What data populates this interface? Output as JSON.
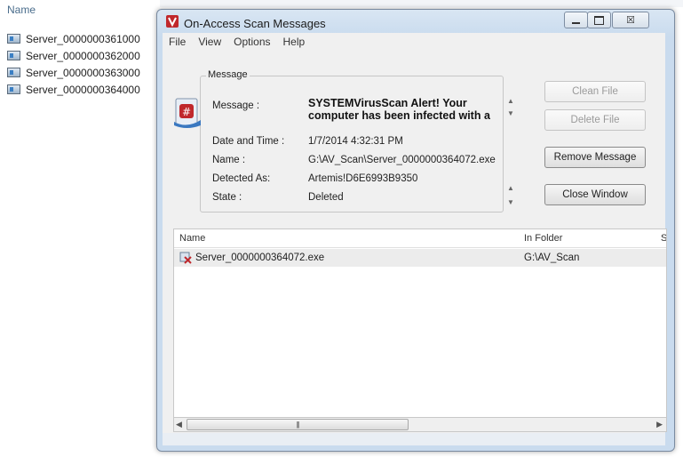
{
  "background": {
    "header": "Name",
    "items": [
      "Server_0000000361000",
      "Server_0000000362000",
      "Server_0000000363000",
      "Server_0000000364000"
    ]
  },
  "window": {
    "title": "On-Access Scan Messages",
    "menu": [
      "File",
      "View",
      "Options",
      "Help"
    ],
    "close_glyph": "☒"
  },
  "message": {
    "group_label": "Message",
    "labels": {
      "message": "Message :",
      "datetime": "Date and Time :",
      "name": "Name :",
      "detected": "Detected As:",
      "state": "State :"
    },
    "values": {
      "message": "SYSTEMVirusScan Alert! Your computer has been infected with a",
      "datetime": "1/7/2014 4:32:31 PM",
      "name": "G:\\AV_Scan\\Server_0000000364072.exe",
      "detected": "Artemis!D6E6993B9350",
      "state": "Deleted"
    }
  },
  "buttons": {
    "clean": "Clean File",
    "delete": "Delete File",
    "remove": "Remove Message",
    "close": "Close Window"
  },
  "list": {
    "columns": [
      "Name",
      "In Folder",
      "S"
    ],
    "rows": [
      {
        "name": "Server_0000000364072.exe",
        "folder": "G:\\AV_Scan"
      }
    ]
  },
  "colors": {
    "window_frame": "#c9dbee",
    "virus_icon_red": "#c0282c"
  }
}
